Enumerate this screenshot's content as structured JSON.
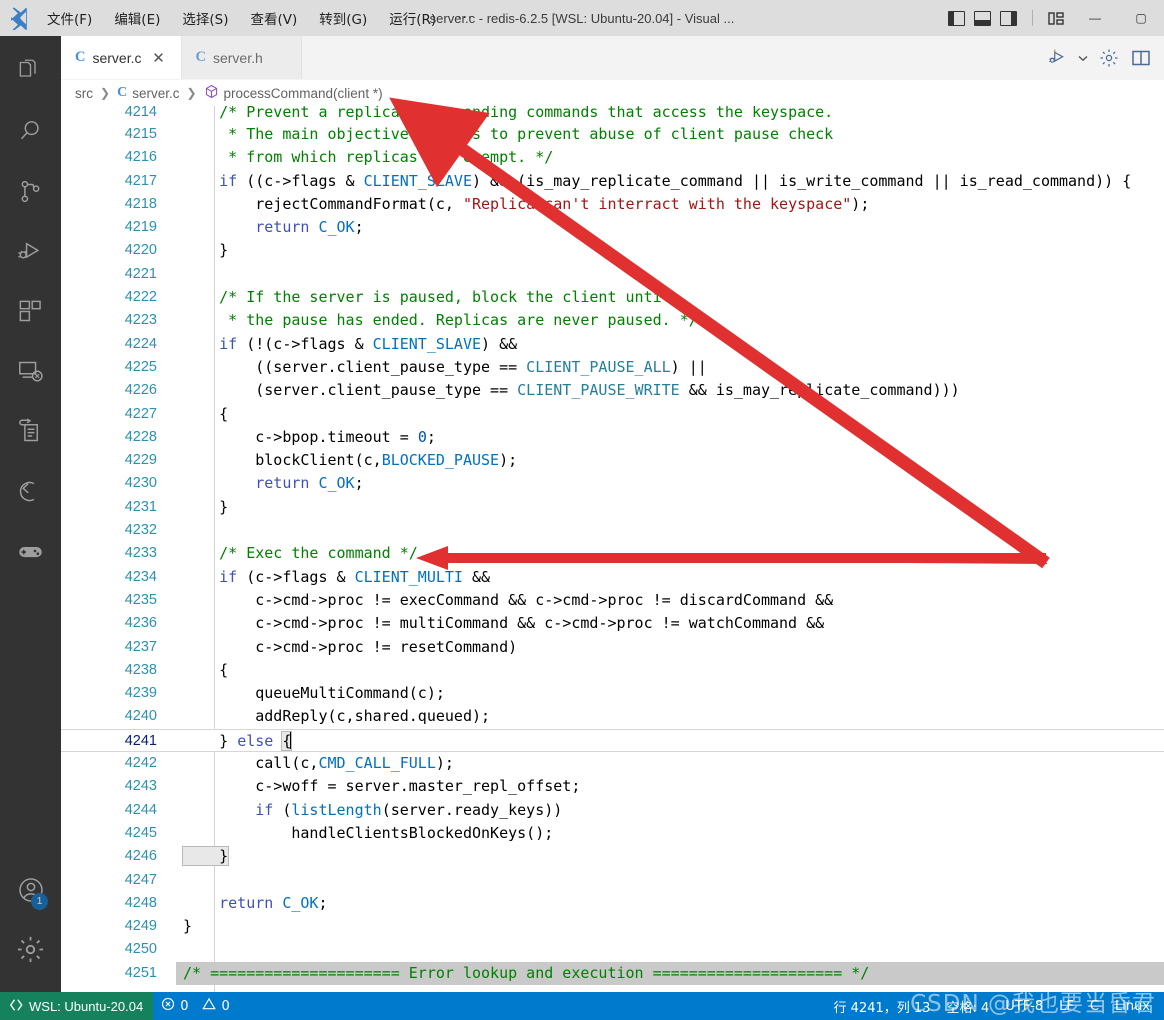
{
  "titlebar": {
    "logo_icon": "vscode-logo-icon",
    "menus": [
      {
        "label": "文件(F)"
      },
      {
        "label": "编辑(E)"
      },
      {
        "label": "选择(S)"
      },
      {
        "label": "查看(V)"
      },
      {
        "label": "转到(G)"
      },
      {
        "label": "运行(R)"
      },
      {
        "label": "···"
      }
    ],
    "title": "server.c - redis-6.2.5 [WSL: Ubuntu-20.04] - Visual ...",
    "layout_icons": [
      "toggle-primary-sidebar-icon",
      "toggle-panel-icon",
      "toggle-secondary-sidebar-icon"
    ],
    "customize_layout_icon": "customize-layout-icon",
    "window_controls": {
      "minimize": "—",
      "maximize": "▢"
    }
  },
  "activitybar": {
    "items": [
      {
        "name": "explorer",
        "icon": "files-icon"
      },
      {
        "name": "search",
        "icon": "search-icon"
      },
      {
        "name": "source-control",
        "icon": "source-control-icon"
      },
      {
        "name": "run-and-debug",
        "icon": "run-and-debug-icon"
      },
      {
        "name": "extensions",
        "icon": "extensions-icon"
      },
      {
        "name": "remote-explorer",
        "icon": "remote-explorer-icon"
      },
      {
        "name": "todo-tree",
        "icon": "clipboard-icon"
      },
      {
        "name": "c-cpp",
        "icon": "cpp-icon"
      },
      {
        "name": "game",
        "icon": "gamepad-icon"
      }
    ],
    "bottom": [
      {
        "name": "accounts",
        "icon": "account-icon",
        "badge": "1"
      },
      {
        "name": "manage",
        "icon": "gear-icon"
      }
    ]
  },
  "tabs": [
    {
      "label": "server.c",
      "ext": "C",
      "active": true,
      "close_icon": "close-icon"
    },
    {
      "label": "server.h",
      "ext": "C",
      "active": false
    }
  ],
  "editor_actions": [
    {
      "name": "run-or-debug",
      "icon": "run-debug-icon"
    },
    {
      "name": "run-dropdown",
      "icon": "chevron-down-icon"
    },
    {
      "name": "c-cpp-config",
      "icon": "gear-icon"
    },
    {
      "name": "split-editor",
      "icon": "split-editor-icon"
    }
  ],
  "breadcrumbs": [
    {
      "label": "src",
      "icon": ""
    },
    {
      "label": "server.c",
      "icon": "c-file-icon"
    },
    {
      "label": "processCommand(client *)",
      "icon": "symbol-method-icon"
    }
  ],
  "code": {
    "first_line": 4214,
    "lines": [
      {
        "n": "4214",
        "clipped": true,
        "tokens": [
          {
            "t": "    ",
            "c": "c-plain"
          },
          {
            "t": "/* Prevent a replica from sending commands that access the keyspace.",
            "c": "c-com"
          }
        ]
      },
      {
        "n": "4215",
        "tokens": [
          {
            "t": "     ",
            "c": "c-plain"
          },
          {
            "t": "* The main objective here is to prevent abuse of client pause check",
            "c": "c-com"
          }
        ]
      },
      {
        "n": "4216",
        "tokens": [
          {
            "t": "     ",
            "c": "c-plain"
          },
          {
            "t": "* from which replicas are exempt. */",
            "c": "c-com"
          }
        ]
      },
      {
        "n": "4217",
        "tokens": [
          {
            "t": "    ",
            "c": "c-plain"
          },
          {
            "t": "if",
            "c": "c-ctrl"
          },
          {
            "t": " ((c->flags & ",
            "c": "c-plain"
          },
          {
            "t": "CLIENT_SLAVE",
            "c": "c-macro"
          },
          {
            "t": ") && (is_may_replicate_command || is_write_command || is_read_command)) {",
            "c": "c-plain"
          }
        ]
      },
      {
        "n": "4218",
        "tokens": [
          {
            "t": "        rejectCommandFormat(c, ",
            "c": "c-plain"
          },
          {
            "t": "\"Replica can't interract with the keyspace\"",
            "c": "c-str"
          },
          {
            "t": ");",
            "c": "c-plain"
          }
        ]
      },
      {
        "n": "4219",
        "tokens": [
          {
            "t": "        ",
            "c": "c-plain"
          },
          {
            "t": "return",
            "c": "c-ctrl"
          },
          {
            "t": " ",
            "c": "c-plain"
          },
          {
            "t": "C_OK",
            "c": "c-macro"
          },
          {
            "t": ";",
            "c": "c-plain"
          }
        ]
      },
      {
        "n": "4220",
        "tokens": [
          {
            "t": "    }",
            "c": "c-plain"
          }
        ]
      },
      {
        "n": "4221",
        "tokens": [
          {
            "t": "",
            "c": "c-plain"
          }
        ]
      },
      {
        "n": "4222",
        "tokens": [
          {
            "t": "    ",
            "c": "c-plain"
          },
          {
            "t": "/* If the server is paused, block the client until",
            "c": "c-com"
          }
        ]
      },
      {
        "n": "4223",
        "tokens": [
          {
            "t": "     ",
            "c": "c-plain"
          },
          {
            "t": "* the pause has ended. Replicas are never paused. */",
            "c": "c-com"
          }
        ]
      },
      {
        "n": "4224",
        "tokens": [
          {
            "t": "    ",
            "c": "c-plain"
          },
          {
            "t": "if",
            "c": "c-ctrl"
          },
          {
            "t": " (!(c->flags & ",
            "c": "c-plain"
          },
          {
            "t": "CLIENT_SLAVE",
            "c": "c-macro"
          },
          {
            "t": ") &&",
            "c": "c-plain"
          }
        ]
      },
      {
        "n": "4225",
        "tokens": [
          {
            "t": "        ((server.client_pause_type == ",
            "c": "c-plain"
          },
          {
            "t": "CLIENT_PAUSE_ALL",
            "c": "c-teal"
          },
          {
            "t": ") ||",
            "c": "c-plain"
          }
        ]
      },
      {
        "n": "4226",
        "tokens": [
          {
            "t": "        (server.client_pause_type == ",
            "c": "c-plain"
          },
          {
            "t": "CLIENT_PAUSE_WRITE",
            "c": "c-teal"
          },
          {
            "t": " && is_may_replicate_command)))",
            "c": "c-plain"
          }
        ]
      },
      {
        "n": "4227",
        "tokens": [
          {
            "t": "    {",
            "c": "c-plain"
          }
        ]
      },
      {
        "n": "4228",
        "tokens": [
          {
            "t": "        c->bpop.timeout = ",
            "c": "c-plain"
          },
          {
            "t": "0",
            "c": "c-num"
          },
          {
            "t": ";",
            "c": "c-plain"
          }
        ]
      },
      {
        "n": "4229",
        "tokens": [
          {
            "t": "        blockClient(c,",
            "c": "c-plain"
          },
          {
            "t": "BLOCKED_PAUSE",
            "c": "c-macro"
          },
          {
            "t": ");",
            "c": "c-plain"
          }
        ]
      },
      {
        "n": "4230",
        "tokens": [
          {
            "t": "        ",
            "c": "c-plain"
          },
          {
            "t": "return",
            "c": "c-ctrl"
          },
          {
            "t": " ",
            "c": "c-plain"
          },
          {
            "t": "C_OK",
            "c": "c-macro"
          },
          {
            "t": ";",
            "c": "c-plain"
          }
        ]
      },
      {
        "n": "4231",
        "tokens": [
          {
            "t": "    }",
            "c": "c-plain"
          }
        ]
      },
      {
        "n": "4232",
        "tokens": [
          {
            "t": "",
            "c": "c-plain"
          }
        ]
      },
      {
        "n": "4233",
        "tokens": [
          {
            "t": "    ",
            "c": "c-plain"
          },
          {
            "t": "/* Exec the command */",
            "c": "c-com"
          }
        ]
      },
      {
        "n": "4234",
        "tokens": [
          {
            "t": "    ",
            "c": "c-plain"
          },
          {
            "t": "if",
            "c": "c-ctrl"
          },
          {
            "t": " (c->flags & ",
            "c": "c-plain"
          },
          {
            "t": "CLIENT_MULTI",
            "c": "c-macro"
          },
          {
            "t": " &&",
            "c": "c-plain"
          }
        ]
      },
      {
        "n": "4235",
        "tokens": [
          {
            "t": "        c->cmd->proc != execCommand && c->cmd->proc != discardCommand &&",
            "c": "c-plain"
          }
        ]
      },
      {
        "n": "4236",
        "tokens": [
          {
            "t": "        c->cmd->proc != multiCommand && c->cmd->proc != watchCommand &&",
            "c": "c-plain"
          }
        ]
      },
      {
        "n": "4237",
        "tokens": [
          {
            "t": "        c->cmd->proc != resetCommand)",
            "c": "c-plain"
          }
        ]
      },
      {
        "n": "4238",
        "tokens": [
          {
            "t": "    {",
            "c": "c-plain"
          }
        ]
      },
      {
        "n": "4239",
        "tokens": [
          {
            "t": "        queueMultiCommand(c);",
            "c": "c-plain"
          }
        ]
      },
      {
        "n": "4240",
        "tokens": [
          {
            "t": "        addReply(c,shared.queued);",
            "c": "c-plain"
          }
        ]
      },
      {
        "n": "4241",
        "current": true,
        "tokens": [
          {
            "t": "    } ",
            "c": "c-plain"
          },
          {
            "t": "else",
            "c": "c-ctrl"
          },
          {
            "t": " ",
            "c": "c-plain"
          },
          {
            "t": "{",
            "c": "c-plain",
            "bracket": true
          },
          {
            "t": "",
            "c": "cursor"
          }
        ]
      },
      {
        "n": "4242",
        "tokens": [
          {
            "t": "        call(c,",
            "c": "c-plain"
          },
          {
            "t": "CMD_CALL_FULL",
            "c": "c-macro"
          },
          {
            "t": ");",
            "c": "c-plain"
          }
        ]
      },
      {
        "n": "4243",
        "tokens": [
          {
            "t": "        c->woff = server.master_repl_offset;",
            "c": "c-plain"
          }
        ]
      },
      {
        "n": "4244",
        "tokens": [
          {
            "t": "        ",
            "c": "c-plain"
          },
          {
            "t": "if",
            "c": "c-ctrl"
          },
          {
            "t": " (",
            "c": "c-plain"
          },
          {
            "t": "listLength",
            "c": "c-macro"
          },
          {
            "t": "(server.ready_keys))",
            "c": "c-plain"
          }
        ]
      },
      {
        "n": "4245",
        "tokens": [
          {
            "t": "            handleClientsBlockedOnKeys();",
            "c": "c-plain"
          }
        ]
      },
      {
        "n": "4246",
        "tokens": [
          {
            "t": "    }",
            "c": "c-plain",
            "bracket": true
          }
        ]
      },
      {
        "n": "4247",
        "tokens": [
          {
            "t": "",
            "c": "c-plain"
          }
        ]
      },
      {
        "n": "4248",
        "tokens": [
          {
            "t": "    ",
            "c": "c-plain"
          },
          {
            "t": "return",
            "c": "c-ctrl"
          },
          {
            "t": " ",
            "c": "c-plain"
          },
          {
            "t": "C_OK",
            "c": "c-macro"
          },
          {
            "t": ";",
            "c": "c-plain"
          }
        ]
      },
      {
        "n": "4249",
        "tokens": [
          {
            "t": "}",
            "c": "c-plain"
          }
        ]
      },
      {
        "n": "4250",
        "tokens": [
          {
            "t": "",
            "c": "c-plain"
          }
        ]
      },
      {
        "n": "4251",
        "selected": true,
        "tokens": [
          {
            "t": "/* ===================== Error lookup and execution ===================== */",
            "c": "c-com"
          }
        ]
      }
    ]
  },
  "statusbar": {
    "remote": {
      "label": "WSL: Ubuntu-20.04",
      "icon": "remote-indicator-icon"
    },
    "problems": {
      "errors": "0",
      "warnings": "0",
      "error_icon": "error-icon",
      "warning_icon": "warning-icon"
    },
    "position": "行 4241，列 13",
    "indentation": "空格: 4",
    "encoding": "UTF-8",
    "eol": "LF",
    "language": "C",
    "platform": "Linux"
  },
  "watermark": "CSDN @我也要当昏君",
  "colors": {
    "titlebar_bg": "#dddddd",
    "activitybar_bg": "#333333",
    "statusbar_bg": "#007acc",
    "remote_bg": "#16825d",
    "badge_bg": "#0e70c0",
    "annotation_red": "#e03030",
    "comment_green": "#008000",
    "keyword_blue": "#0000ff",
    "string_red": "#a31515",
    "linenumber_teal": "#2b91af"
  }
}
